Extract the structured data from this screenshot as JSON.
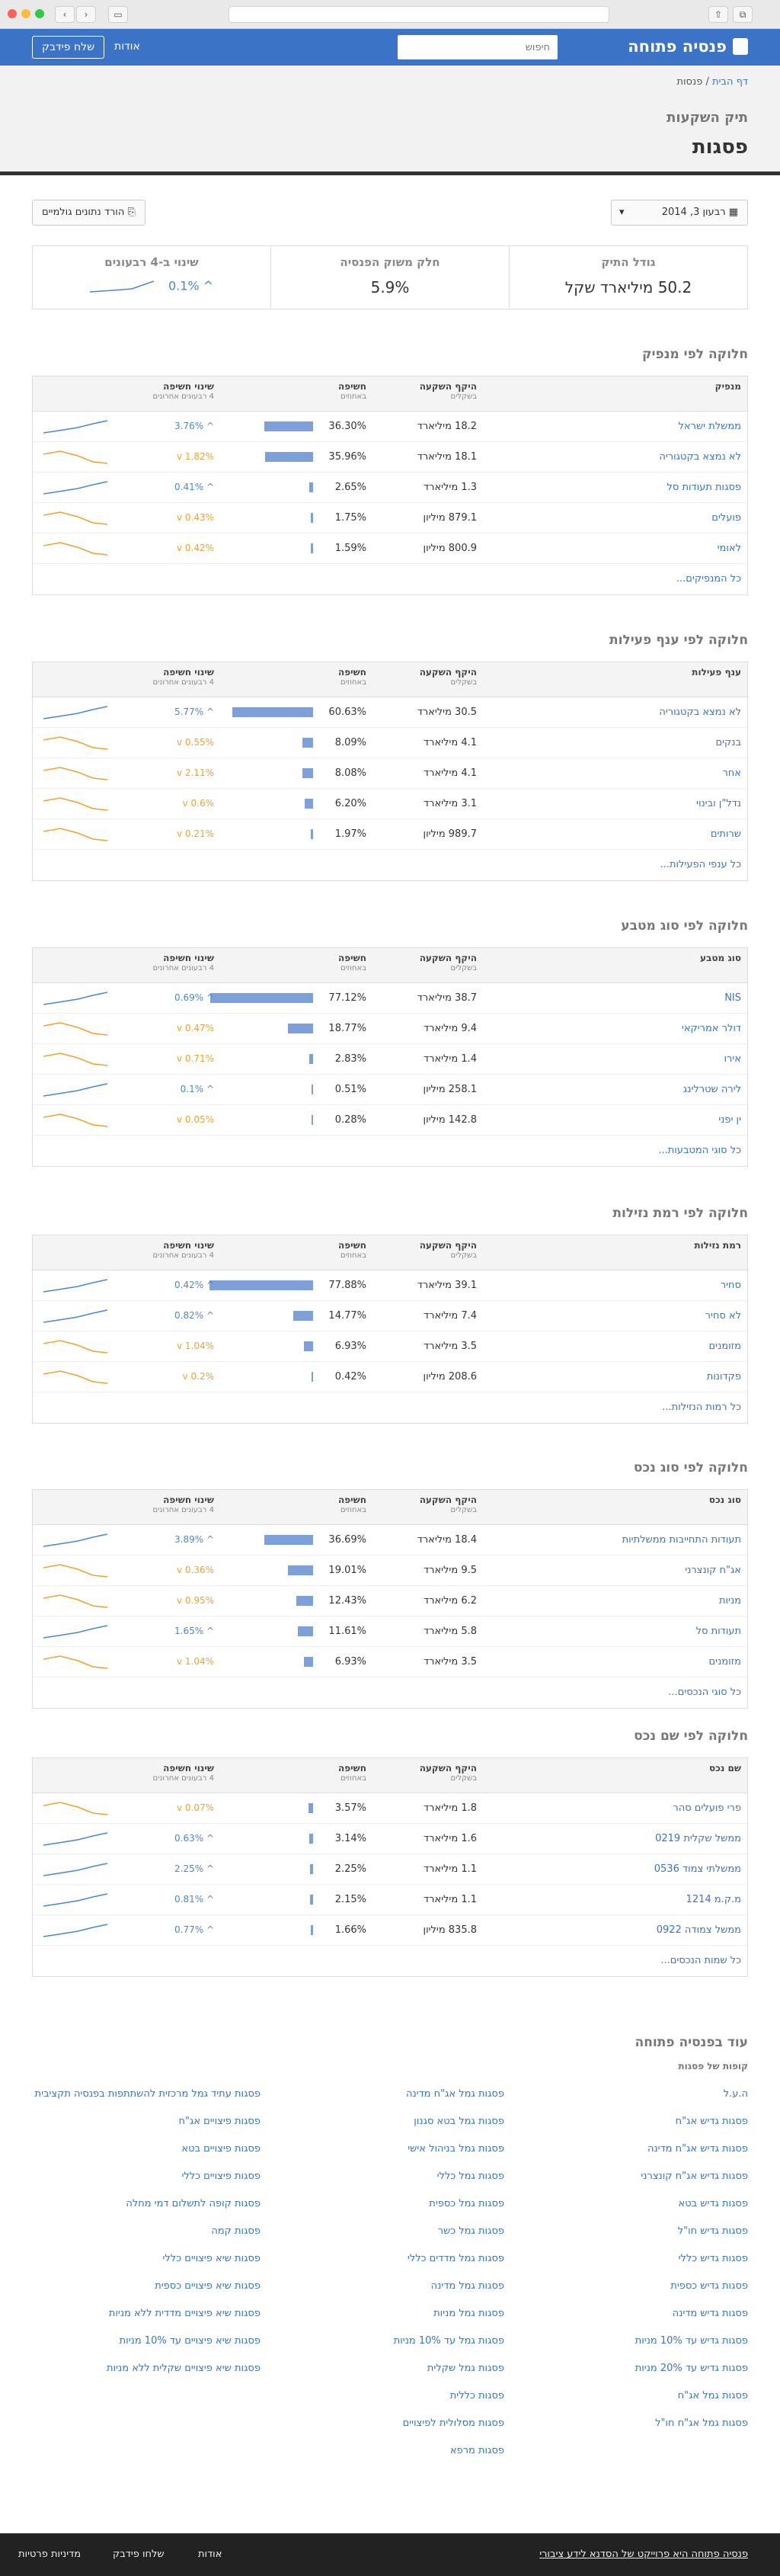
{
  "header": {
    "site_name": "פנסיה פתוחה",
    "search_placeholder": "חיפוש",
    "about": "אודות",
    "feedback": "שלח פידבק"
  },
  "breadcrumb": {
    "home": "דף הבית",
    "current": "פנסות"
  },
  "page": {
    "subtitle": "תיק השקעות",
    "title": "פסגות"
  },
  "controls": {
    "date": "רבעון 3, 2014",
    "download": "הורד נתונים גולמיים"
  },
  "stats": [
    {
      "label": "גודל התיק",
      "value": "50.2 מיליארד שקל"
    },
    {
      "label": "חלק משוק הפנסיה",
      "value": "5.9%"
    },
    {
      "label": "שינוי ב-4 רבעונים",
      "value": "^ 0.1%"
    }
  ],
  "colors": {
    "up": "#4a86d6",
    "down": "#f0a132",
    "bar": "#7da0d8",
    "brand": "#3b73c6"
  },
  "sections": [
    {
      "title": "חלוקה לפי מנפיק",
      "col1": "מנפיק",
      "more": "כל המנפיקים...",
      "rows": [
        {
          "name": "ממשלת ישראל",
          "vol": "18.2 מיליארד",
          "exp": "36.30%",
          "pct": 36.3,
          "chg": "^ 3.76%",
          "dir": "up"
        },
        {
          "name": "לא נמצא בקטגוריה",
          "vol": "18.1 מיליארד",
          "exp": "35.96%",
          "pct": 35.96,
          "chg": "v 1.82%",
          "dir": "down"
        },
        {
          "name": "פסגות תעודות סל",
          "vol": "1.3 מיליארד",
          "exp": "2.65%",
          "pct": 2.65,
          "chg": "^ 0.41%",
          "dir": "up"
        },
        {
          "name": "פועלים",
          "vol": "879.1 מיליון",
          "exp": "1.75%",
          "pct": 1.75,
          "chg": "v 0.43%",
          "dir": "down"
        },
        {
          "name": "לאומי",
          "vol": "800.9 מיליון",
          "exp": "1.59%",
          "pct": 1.59,
          "chg": "v 0.42%",
          "dir": "down"
        }
      ]
    },
    {
      "title": "חלוקה לפי ענף פעילות",
      "col1": "ענף פעילות",
      "more": "כל ענפי הפעילות...",
      "rows": [
        {
          "name": "לא נמצא בקטגוריה",
          "vol": "30.5 מיליארד",
          "exp": "60.63%",
          "pct": 60.63,
          "chg": "^ 5.77%",
          "dir": "up"
        },
        {
          "name": "בנקים",
          "vol": "4.1 מיליארד",
          "exp": "8.09%",
          "pct": 8.09,
          "chg": "v 0.55%",
          "dir": "down"
        },
        {
          "name": "אחר",
          "vol": "4.1 מיליארד",
          "exp": "8.08%",
          "pct": 8.08,
          "chg": "v 2.11%",
          "dir": "down"
        },
        {
          "name": "נדל\"ן ובינוי",
          "vol": "3.1 מיליארד",
          "exp": "6.20%",
          "pct": 6.2,
          "chg": "v 0.6%",
          "dir": "down"
        },
        {
          "name": "שרותים",
          "vol": "989.7 מיליון",
          "exp": "1.97%",
          "pct": 1.97,
          "chg": "v 0.21%",
          "dir": "down"
        }
      ]
    },
    {
      "title": "חלוקה לפי סוג מטבע",
      "col1": "סוג מטבע",
      "more": "כל סוגי המטבעות...",
      "rows": [
        {
          "name": "NIS",
          "vol": "38.7 מיליארד",
          "exp": "77.12%",
          "pct": 77.12,
          "chg": "^ 0.69%",
          "dir": "up"
        },
        {
          "name": "דולר אמריקאי",
          "vol": "9.4 מיליארד",
          "exp": "18.77%",
          "pct": 18.77,
          "chg": "v 0.47%",
          "dir": "down"
        },
        {
          "name": "אירו",
          "vol": "1.4 מיליארד",
          "exp": "2.83%",
          "pct": 2.83,
          "chg": "v 0.71%",
          "dir": "down"
        },
        {
          "name": "לירה שטרלינג",
          "vol": "258.1 מיליון",
          "exp": "0.51%",
          "pct": 0.51,
          "chg": "^ 0.1%",
          "dir": "up"
        },
        {
          "name": "ין יפני",
          "vol": "142.8 מיליון",
          "exp": "0.28%",
          "pct": 0.28,
          "chg": "v 0.05%",
          "dir": "down"
        }
      ]
    },
    {
      "title": "חלוקה לפי רמת נזילות",
      "col1": "רמת נזילות",
      "more": "כל רמות הנזילות...",
      "rows": [
        {
          "name": "סחיר",
          "vol": "39.1 מיליארד",
          "exp": "77.88%",
          "pct": 77.88,
          "chg": "^ 0.42%",
          "dir": "up"
        },
        {
          "name": "לא סחיר",
          "vol": "7.4 מיליארד",
          "exp": "14.77%",
          "pct": 14.77,
          "chg": "^ 0.82%",
          "dir": "up"
        },
        {
          "name": "מזומנים",
          "vol": "3.5 מיליארד",
          "exp": "6.93%",
          "pct": 6.93,
          "chg": "v 1.04%",
          "dir": "down"
        },
        {
          "name": "פקדונות",
          "vol": "208.6 מיליון",
          "exp": "0.42%",
          "pct": 0.42,
          "chg": "v 0.2%",
          "dir": "down"
        }
      ]
    },
    {
      "title": "חלוקה לפי סוג נכס",
      "col1": "סוג נכס",
      "more": "כל סוגי הנכסים...",
      "rows": [
        {
          "name": "תעודות התחייבות ממשלתיות",
          "vol": "18.4 מיליארד",
          "exp": "36.69%",
          "pct": 36.69,
          "chg": "^ 3.89%",
          "dir": "up"
        },
        {
          "name": "אג\"ח קונצרני",
          "vol": "9.5 מיליארד",
          "exp": "19.01%",
          "pct": 19.01,
          "chg": "v 0.36%",
          "dir": "down"
        },
        {
          "name": "מניות",
          "vol": "6.2 מיליארד",
          "exp": "12.43%",
          "pct": 12.43,
          "chg": "v 0.95%",
          "dir": "down"
        },
        {
          "name": "תעודות סל",
          "vol": "5.8 מיליארד",
          "exp": "11.61%",
          "pct": 11.61,
          "chg": "^ 1.65%",
          "dir": "up"
        },
        {
          "name": "מזומנים",
          "vol": "3.5 מיליארד",
          "exp": "6.93%",
          "pct": 6.93,
          "chg": "v 1.04%",
          "dir": "down"
        }
      ]
    },
    {
      "title": "חלוקה לפי שם נכס",
      "col1": "שם נכס",
      "more": "כל שמות הנכסים...",
      "rows": [
        {
          "name": "פרי פועלים סהר",
          "vol": "1.8 מיליארד",
          "exp": "3.57%",
          "pct": 3.57,
          "chg": "v 0.07%",
          "dir": "down"
        },
        {
          "name": "ממשל שקלית 0219",
          "vol": "1.6 מיליארד",
          "exp": "3.14%",
          "pct": 3.14,
          "chg": "^ 0.63%",
          "dir": "up"
        },
        {
          "name": "ממשלתי צמוד 0536",
          "vol": "1.1 מיליארד",
          "exp": "2.25%",
          "pct": 2.25,
          "chg": "^ 2.25%",
          "dir": "up"
        },
        {
          "name": "מ.ק.מ 1214",
          "vol": "1.1 מיליארד",
          "exp": "2.15%",
          "pct": 2.15,
          "chg": "^ 0.81%",
          "dir": "up"
        },
        {
          "name": "ממשל צמודה 0922",
          "vol": "835.8 מיליון",
          "exp": "1.66%",
          "pct": 1.66,
          "chg": "^ 0.77%",
          "dir": "up"
        }
      ]
    }
  ],
  "table_headers": {
    "vol": "היקף השקעה",
    "vol_sub": "בשקלים",
    "exp": "חשיפה",
    "exp_sub": "באחוזים",
    "chg": "שינוי חשיפה",
    "chg_sub": "4 רבעונים אחרונים"
  },
  "more_funds": {
    "title": "עוד בפנסיה פתוחה",
    "subtitle": "קופות של פסגות",
    "col1": [
      "ה.ע.ל",
      "פסגות גדיש אג\"ח",
      "פסגות גדיש אג\"ח מדינה",
      "פסגות גדיש אג\"ח קונצרני",
      "פסגות גדיש בטא",
      "פסגות גדיש חו\"ל",
      "פסגות גדיש כללי",
      "פסגות גדיש כספית",
      "פסגות גדיש מדינה",
      "פסגות גדיש עד 10% מניות",
      "פסגות גדיש עד 20% מניות",
      "פסגות גמל אג\"ח",
      "פסגות גמל אג\"ח חו\"ל"
    ],
    "col2": [
      "פסגות גמל אג\"ח מדינה",
      "פסגות גמל בטא סגנון",
      "פסגות גמל בניהול אישי",
      "פסגות גמל כללי",
      "פסגות גמל כספית",
      "פסגות גמל כשר",
      "פסגות גמל מדדים כללי",
      "פסגות גמל מדינה",
      "פסגות גמל מניות",
      "פסגות גמל עד 10% מניות",
      "פסגות גמל שקלית",
      "פסגות כללית",
      "פסגות מסלולית לפיצויים",
      "פסגות מרפא"
    ],
    "col3": [
      "פסגות עתיד גמל מרכזית להשתתפות בפנסיה תקציבית",
      "פסגות פיצויים אג\"ח",
      "פסגות פיצויים בטא",
      "פסגות פיצויים כללי",
      "פסגות קופה לתשלום דמי מחלה",
      "פסגות קמה",
      "פסגות שיא פיצויים כללי",
      "פסגות שיא פיצויים כספית",
      "פסגות שיא פיצויים מדדית ללא מניות",
      "פסגות שיא פיצויים עד 10% מניות",
      "פסגות שיא פיצויים שקלית ללא מניות"
    ]
  },
  "footer": {
    "text": "פנסיה פתוחה היא פרוייקט של הסדנא לידע ציבורי",
    "about": "אודות",
    "feedback": "שלחו פידבק",
    "privacy": "מדיניות פרטיות"
  }
}
